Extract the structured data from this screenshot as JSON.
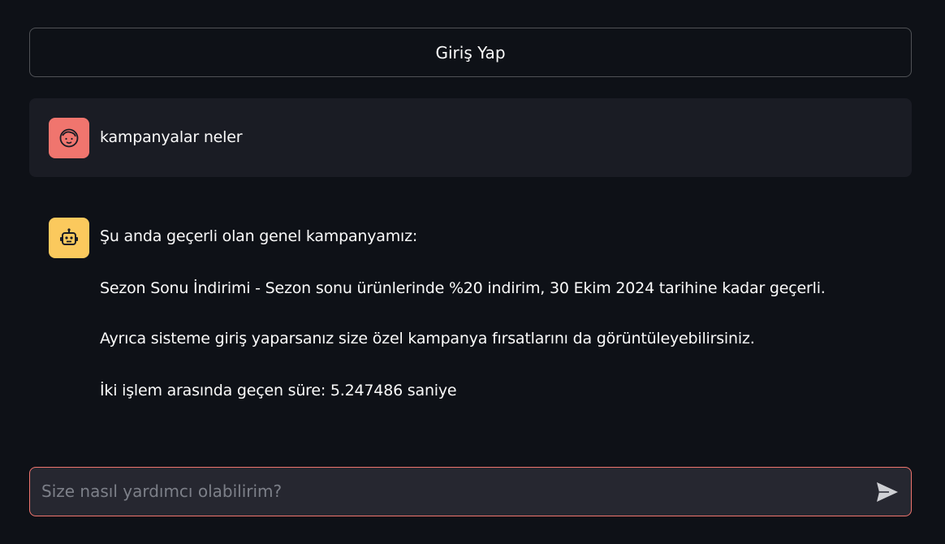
{
  "login_button": {
    "label": "Giriş Yap"
  },
  "messages": [
    {
      "role": "user",
      "avatar_icon": "user-face-icon",
      "avatar_color": "#f0756e",
      "text": "kampanyalar neler"
    },
    {
      "role": "assistant",
      "avatar_icon": "robot-icon",
      "avatar_color": "#fbc95d",
      "lines": [
        "Şu anda geçerli olan genel kampanyamız:",
        "Sezon Sonu İndirimi - Sezon sonu ürünlerinde %20 indirim, 30 Ekim 2024 tarihine kadar geçerli.",
        "Ayrıca sisteme giriş yaparsanız size özel kampanya fırsatlarını da görüntüleyebilirsiniz.",
        "İki işlem arasında geçen süre: 5.247486 saniye"
      ]
    }
  ],
  "chat_input": {
    "placeholder": "Size nasıl yardımcı olabilirim?",
    "value": "",
    "send_icon": "send-arrow-icon",
    "border_color": "#f0756e"
  },
  "theme": {
    "background": "#0e1117",
    "user_message_background": "#1a1c24",
    "text_color": "#fafafa"
  }
}
